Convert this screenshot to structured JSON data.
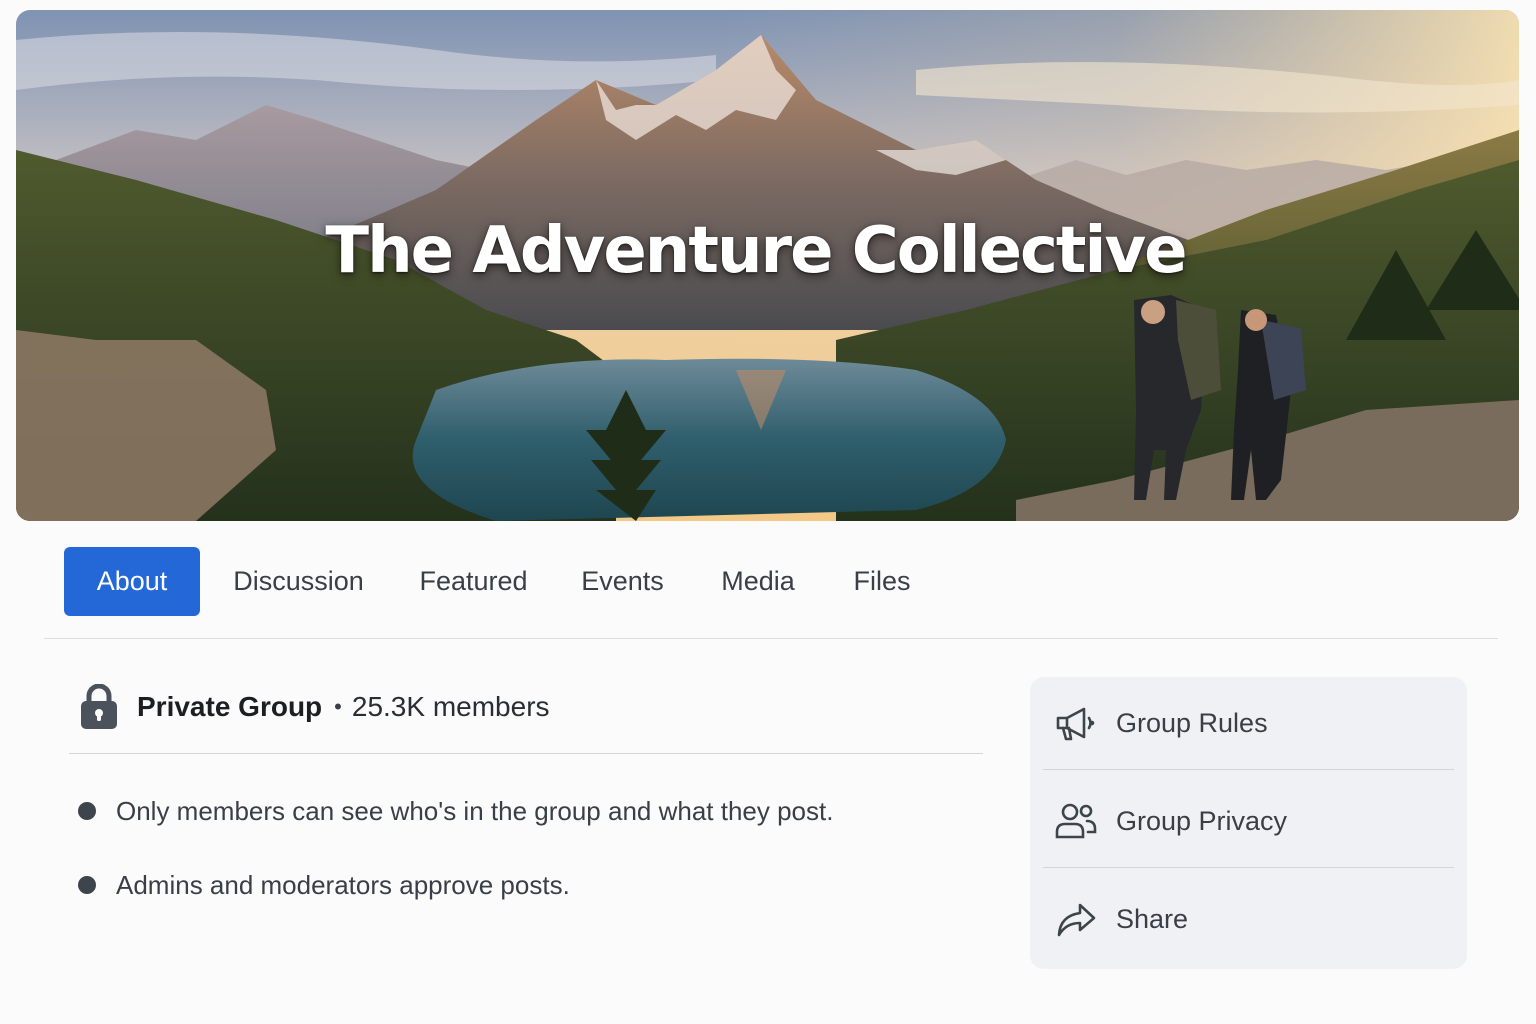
{
  "cover": {
    "title": "The Adventure Collective"
  },
  "tabs": [
    {
      "label": "About",
      "active": true
    },
    {
      "label": "Discussion",
      "active": false
    },
    {
      "label": "Featured",
      "active": false
    },
    {
      "label": "Events",
      "active": false
    },
    {
      "label": "Media",
      "active": false
    },
    {
      "label": "Files",
      "active": false
    }
  ],
  "about": {
    "privacy_label": "Private Group",
    "separator": "•",
    "members": "25.3K members",
    "privacy_icon": "lock-icon",
    "bullets": [
      "Only members can see who's in the group and what they post.",
      "Admins and moderators approve posts."
    ]
  },
  "side_panel": {
    "items": [
      {
        "label": "Group Rules",
        "icon": "megaphone-icon"
      },
      {
        "label": "Group Privacy",
        "icon": "people-icon"
      },
      {
        "label": "Share",
        "icon": "share-arrow-icon"
      }
    ]
  },
  "colors": {
    "accent": "#2368d6",
    "text": "#3a3f47",
    "panel_bg": "#f0f1f4"
  }
}
